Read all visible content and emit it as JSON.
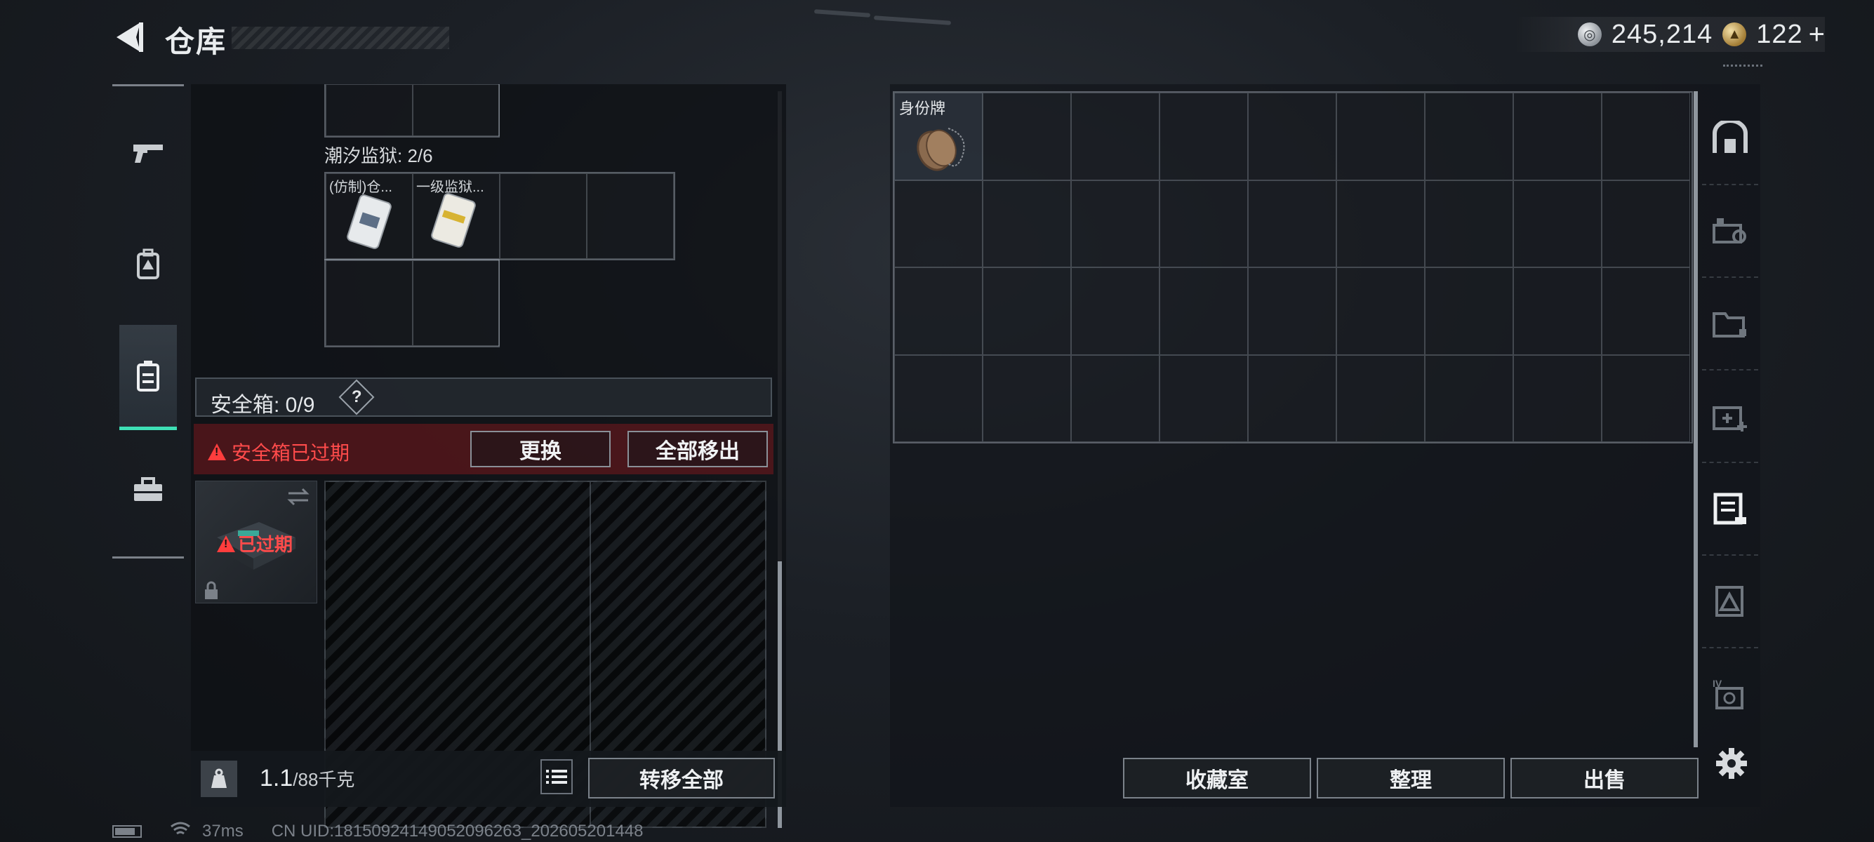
{
  "header": {
    "title": "仓库",
    "back_icon": "back-arrow-icon"
  },
  "currency": {
    "silver": "245,214",
    "gold": "122",
    "gold_plus": "+"
  },
  "left_tabs": [
    {
      "id": "weapons",
      "icon": "pistol-icon"
    },
    {
      "id": "gear",
      "icon": "backpack-icon"
    },
    {
      "id": "container",
      "icon": "safebox-icon",
      "active": true
    },
    {
      "id": "toolbox",
      "icon": "toolbox-icon"
    }
  ],
  "container": {
    "sub_label": "潮汐监狱: 2/6",
    "items": [
      {
        "name": "(仿制)仓..."
      },
      {
        "name": "一级监狱..."
      }
    ]
  },
  "safebox": {
    "label": "安全箱: 0/9",
    "help": "?",
    "warning": "安全箱已过期",
    "replace_button": "更换",
    "remove_all_button": "全部移出",
    "expired_tag": "已过期"
  },
  "weight": {
    "current": "1.1",
    "max": "/88千克",
    "transfer_all": "转移全部"
  },
  "stash": {
    "dogtag_name": "身份牌"
  },
  "bottom_actions": {
    "collection": "收藏室",
    "organize": "整理",
    "sell": "出售"
  },
  "status": {
    "ping": "37ms",
    "uid": "CN UID:181509241490520962­63_202605201448"
  },
  "colors": {
    "accent": "#3ee0b6",
    "warning": "#ff4b4b"
  }
}
